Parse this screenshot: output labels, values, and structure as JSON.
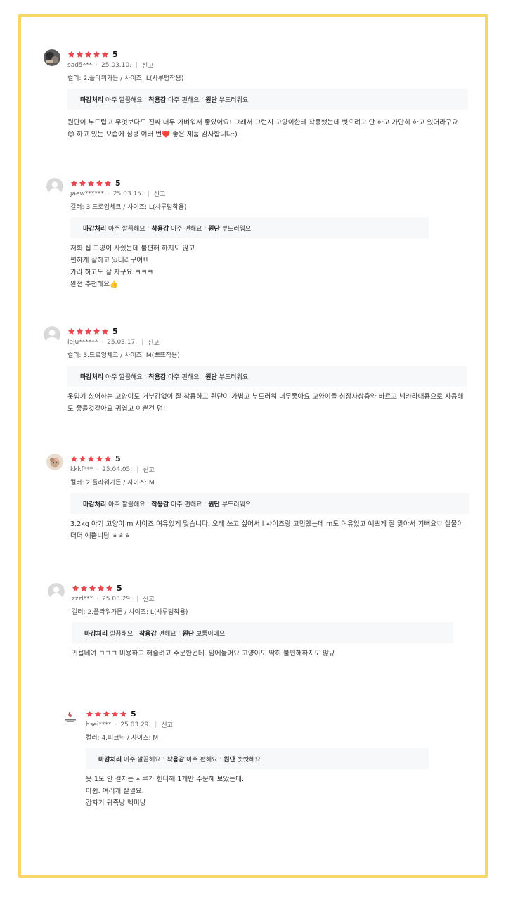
{
  "colors": {
    "frame": "#f7d768",
    "star": "#e8484f",
    "tagbox": "#f7f8fa"
  },
  "reviews": [
    {
      "avatar": "dark-photo-avatar",
      "score": "5",
      "user": "sad5***",
      "date": "25.03.10.",
      "report": "신고",
      "option": "컬러: 2.플라워가든 / 사이즈: L(사루텅착용)",
      "tags": [
        {
          "k": "마감처리",
          "v": "아주 깔끔해요"
        },
        {
          "k": "착용감",
          "v": "아주 편해요"
        },
        {
          "k": "원단",
          "v": "부드러워요"
        }
      ],
      "lines": [
        "원단이 부드럽고 무엇보다도 진짜 너무 가벼워서 좋았어요! 그래서 그런지 고양이한테 착용했는데 벗으려고 안 하고 가만히 하고 있더라구요😍 하고 있는 모습에 심쿵 여러 번❤️ 좋은 제품 감사합니다:)"
      ]
    },
    {
      "avatar": "default-avatar",
      "score": "5",
      "user": "jaew******",
      "date": "25.03.15.",
      "report": "신고",
      "option": "컬러: 3.드로잉체크 / 사이즈: L(사루텅착용)",
      "tags": [
        {
          "k": "마감처리",
          "v": "아주 깔끔해요"
        },
        {
          "k": "착용감",
          "v": "아주 편해요"
        },
        {
          "k": "원단",
          "v": "부드러워요"
        }
      ],
      "lines": [
        "저희 집 고양이 사줬는데 불편해 하지도 않고",
        "편하게 잘하고 있더라구여!!",
        "카라 하고도 잘 자구요 ㅋㅋㅋ",
        "완전 추천해요👍"
      ]
    },
    {
      "avatar": "default-avatar",
      "score": "5",
      "user": "leju******",
      "date": "25.03.17.",
      "report": "신고",
      "option": "컬러: 3.드로잉체크 / 사이즈: M(뽀뜨착용)",
      "tags": [
        {
          "k": "마감처리",
          "v": "아주 깔끔해요"
        },
        {
          "k": "착용감",
          "v": "아주 편해요"
        },
        {
          "k": "원단",
          "v": "부드러워요"
        }
      ],
      "lines": [
        "옷입기 싫어하는 고양이도 거부감없이 잘 착용하고 원단이 가볍고 부드러워 너무좋아요 고양이들 심장사상충약 바르고 넥카라대용으로 사용해도 좋을것같아요 귀엽고 이쁜건 덤!!"
      ]
    },
    {
      "avatar": "cat-photo-avatar",
      "score": "5",
      "user": "kkkf***",
      "date": "25.04.05.",
      "report": "신고",
      "option": "컬러: 2.플라워가든 / 사이즈: M",
      "tags": [
        {
          "k": "마감처리",
          "v": "아주 깔끔해요"
        },
        {
          "k": "착용감",
          "v": "아주 편해요"
        },
        {
          "k": "원단",
          "v": "부드러워요"
        }
      ],
      "lines": [
        "3.2kg 아기 고양이 m 사이즈 여유있게 맞습니다. 오래 쓰고 싶어서 l 사이즈랑 고민했는데 m도 여유있고 예쁘게 잘 맞아서 기뻐요♡ 실물이 더더 예쁩니당 ㅎㅎㅎ"
      ]
    },
    {
      "avatar": "default-avatar",
      "score": "5",
      "user": "zzzl***",
      "date": "25.03.29.",
      "report": "신고",
      "option": "컬러: 2.플라워가든 / 사이즈: L(사루텅착용)",
      "tags": [
        {
          "k": "마감처리",
          "v": "깔끔해요"
        },
        {
          "k": "착용감",
          "v": "편해요"
        },
        {
          "k": "원단",
          "v": "보통이에요"
        }
      ],
      "lines": [
        "귀욥네여 ㅋㅋㅋ 미용하고 해줄려고 주문한건데. 맘에들어요 고양이도 딱히 불편해하지도 않규"
      ]
    },
    {
      "avatar": "logo-avatar",
      "score": "5",
      "user": "hsei****",
      "date": "25.03.29.",
      "report": "신고",
      "option": "컬러: 4.피크닉 / 사이즈: M",
      "tags": [
        {
          "k": "마감처리",
          "v": "아주 깔끔해요"
        },
        {
          "k": "착용감",
          "v": "아주 편해요"
        },
        {
          "k": "원단",
          "v": "빳빳해요"
        }
      ],
      "lines": [
        "옷 1도 안 걸치는 시루가 헌다해 1개만 주문해 보았는데.",
        "아쉽. 여러개 살껄요.",
        "갑자기 귀족냥 멕미냥"
      ]
    }
  ]
}
